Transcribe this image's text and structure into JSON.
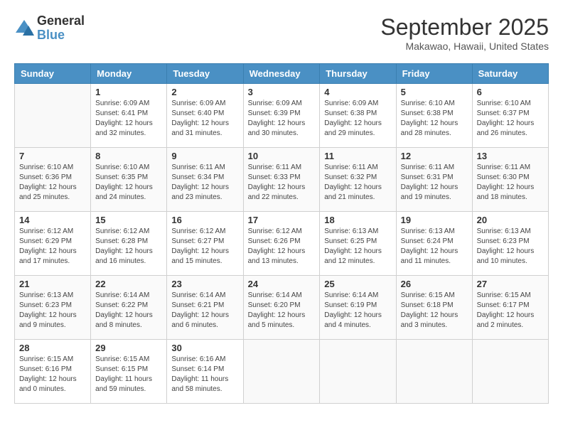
{
  "logo": {
    "general": "General",
    "blue": "Blue"
  },
  "header": {
    "month": "September 2025",
    "location": "Makawao, Hawaii, United States"
  },
  "days_of_week": [
    "Sunday",
    "Monday",
    "Tuesday",
    "Wednesday",
    "Thursday",
    "Friday",
    "Saturday"
  ],
  "weeks": [
    [
      {
        "day": "",
        "sunrise": "",
        "sunset": "",
        "daylight": ""
      },
      {
        "day": "1",
        "sunrise": "Sunrise: 6:09 AM",
        "sunset": "Sunset: 6:41 PM",
        "daylight": "Daylight: 12 hours and 32 minutes."
      },
      {
        "day": "2",
        "sunrise": "Sunrise: 6:09 AM",
        "sunset": "Sunset: 6:40 PM",
        "daylight": "Daylight: 12 hours and 31 minutes."
      },
      {
        "day": "3",
        "sunrise": "Sunrise: 6:09 AM",
        "sunset": "Sunset: 6:39 PM",
        "daylight": "Daylight: 12 hours and 30 minutes."
      },
      {
        "day": "4",
        "sunrise": "Sunrise: 6:09 AM",
        "sunset": "Sunset: 6:38 PM",
        "daylight": "Daylight: 12 hours and 29 minutes."
      },
      {
        "day": "5",
        "sunrise": "Sunrise: 6:10 AM",
        "sunset": "Sunset: 6:38 PM",
        "daylight": "Daylight: 12 hours and 28 minutes."
      },
      {
        "day": "6",
        "sunrise": "Sunrise: 6:10 AM",
        "sunset": "Sunset: 6:37 PM",
        "daylight": "Daylight: 12 hours and 26 minutes."
      }
    ],
    [
      {
        "day": "7",
        "sunrise": "Sunrise: 6:10 AM",
        "sunset": "Sunset: 6:36 PM",
        "daylight": "Daylight: 12 hours and 25 minutes."
      },
      {
        "day": "8",
        "sunrise": "Sunrise: 6:10 AM",
        "sunset": "Sunset: 6:35 PM",
        "daylight": "Daylight: 12 hours and 24 minutes."
      },
      {
        "day": "9",
        "sunrise": "Sunrise: 6:11 AM",
        "sunset": "Sunset: 6:34 PM",
        "daylight": "Daylight: 12 hours and 23 minutes."
      },
      {
        "day": "10",
        "sunrise": "Sunrise: 6:11 AM",
        "sunset": "Sunset: 6:33 PM",
        "daylight": "Daylight: 12 hours and 22 minutes."
      },
      {
        "day": "11",
        "sunrise": "Sunrise: 6:11 AM",
        "sunset": "Sunset: 6:32 PM",
        "daylight": "Daylight: 12 hours and 21 minutes."
      },
      {
        "day": "12",
        "sunrise": "Sunrise: 6:11 AM",
        "sunset": "Sunset: 6:31 PM",
        "daylight": "Daylight: 12 hours and 19 minutes."
      },
      {
        "day": "13",
        "sunrise": "Sunrise: 6:11 AM",
        "sunset": "Sunset: 6:30 PM",
        "daylight": "Daylight: 12 hours and 18 minutes."
      }
    ],
    [
      {
        "day": "14",
        "sunrise": "Sunrise: 6:12 AM",
        "sunset": "Sunset: 6:29 PM",
        "daylight": "Daylight: 12 hours and 17 minutes."
      },
      {
        "day": "15",
        "sunrise": "Sunrise: 6:12 AM",
        "sunset": "Sunset: 6:28 PM",
        "daylight": "Daylight: 12 hours and 16 minutes."
      },
      {
        "day": "16",
        "sunrise": "Sunrise: 6:12 AM",
        "sunset": "Sunset: 6:27 PM",
        "daylight": "Daylight: 12 hours and 15 minutes."
      },
      {
        "day": "17",
        "sunrise": "Sunrise: 6:12 AM",
        "sunset": "Sunset: 6:26 PM",
        "daylight": "Daylight: 12 hours and 13 minutes."
      },
      {
        "day": "18",
        "sunrise": "Sunrise: 6:13 AM",
        "sunset": "Sunset: 6:25 PM",
        "daylight": "Daylight: 12 hours and 12 minutes."
      },
      {
        "day": "19",
        "sunrise": "Sunrise: 6:13 AM",
        "sunset": "Sunset: 6:24 PM",
        "daylight": "Daylight: 12 hours and 11 minutes."
      },
      {
        "day": "20",
        "sunrise": "Sunrise: 6:13 AM",
        "sunset": "Sunset: 6:23 PM",
        "daylight": "Daylight: 12 hours and 10 minutes."
      }
    ],
    [
      {
        "day": "21",
        "sunrise": "Sunrise: 6:13 AM",
        "sunset": "Sunset: 6:23 PM",
        "daylight": "Daylight: 12 hours and 9 minutes."
      },
      {
        "day": "22",
        "sunrise": "Sunrise: 6:14 AM",
        "sunset": "Sunset: 6:22 PM",
        "daylight": "Daylight: 12 hours and 8 minutes."
      },
      {
        "day": "23",
        "sunrise": "Sunrise: 6:14 AM",
        "sunset": "Sunset: 6:21 PM",
        "daylight": "Daylight: 12 hours and 6 minutes."
      },
      {
        "day": "24",
        "sunrise": "Sunrise: 6:14 AM",
        "sunset": "Sunset: 6:20 PM",
        "daylight": "Daylight: 12 hours and 5 minutes."
      },
      {
        "day": "25",
        "sunrise": "Sunrise: 6:14 AM",
        "sunset": "Sunset: 6:19 PM",
        "daylight": "Daylight: 12 hours and 4 minutes."
      },
      {
        "day": "26",
        "sunrise": "Sunrise: 6:15 AM",
        "sunset": "Sunset: 6:18 PM",
        "daylight": "Daylight: 12 hours and 3 minutes."
      },
      {
        "day": "27",
        "sunrise": "Sunrise: 6:15 AM",
        "sunset": "Sunset: 6:17 PM",
        "daylight": "Daylight: 12 hours and 2 minutes."
      }
    ],
    [
      {
        "day": "28",
        "sunrise": "Sunrise: 6:15 AM",
        "sunset": "Sunset: 6:16 PM",
        "daylight": "Daylight: 12 hours and 0 minutes."
      },
      {
        "day": "29",
        "sunrise": "Sunrise: 6:15 AM",
        "sunset": "Sunset: 6:15 PM",
        "daylight": "Daylight: 11 hours and 59 minutes."
      },
      {
        "day": "30",
        "sunrise": "Sunrise: 6:16 AM",
        "sunset": "Sunset: 6:14 PM",
        "daylight": "Daylight: 11 hours and 58 minutes."
      },
      {
        "day": "",
        "sunrise": "",
        "sunset": "",
        "daylight": ""
      },
      {
        "day": "",
        "sunrise": "",
        "sunset": "",
        "daylight": ""
      },
      {
        "day": "",
        "sunrise": "",
        "sunset": "",
        "daylight": ""
      },
      {
        "day": "",
        "sunrise": "",
        "sunset": "",
        "daylight": ""
      }
    ]
  ]
}
